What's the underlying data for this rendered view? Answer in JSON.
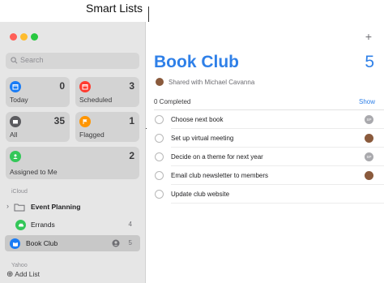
{
  "callout": {
    "label": "Smart Lists"
  },
  "sidebar": {
    "search_placeholder": "Search",
    "smart_lists": [
      {
        "label": "Today",
        "count": "0",
        "color": "#1a7cf5",
        "icon": "calendar-icon"
      },
      {
        "label": "Scheduled",
        "count": "3",
        "color": "#ff3b30",
        "icon": "calendar-icon"
      },
      {
        "label": "All",
        "count": "35",
        "color": "#5b5b5f",
        "icon": "tray-icon"
      },
      {
        "label": "Flagged",
        "count": "1",
        "color": "#ff9500",
        "icon": "flag-icon"
      },
      {
        "label": "Assigned to Me",
        "count": "2",
        "color": "#34c759",
        "icon": "person-icon"
      }
    ],
    "icloud_header": "iCloud",
    "lists": [
      {
        "label": "Event Planning",
        "count": "",
        "icon": "folder-icon"
      },
      {
        "label": "Errands",
        "count": "4",
        "color": "#34c759",
        "icon": "car-icon"
      },
      {
        "label": "Book Club",
        "count": "5",
        "color": "#1a7cf5",
        "icon": "book-icon"
      }
    ],
    "yahoo_header": "Yahoo",
    "add_list": "Add List"
  },
  "main": {
    "title": "Book Club",
    "total": "5",
    "shared": "Shared with Michael Cavanna",
    "completed": "0 Completed",
    "show": "Show",
    "tasks": [
      {
        "label": "Choose next book",
        "avatar": "SP"
      },
      {
        "label": "Set up virtual meeting",
        "avatar": ""
      },
      {
        "label": "Decide on a theme for next year",
        "avatar": "SP"
      },
      {
        "label": "Email club newsletter to members",
        "avatar": ""
      },
      {
        "label": "Update club website",
        "avatar": ""
      }
    ]
  }
}
